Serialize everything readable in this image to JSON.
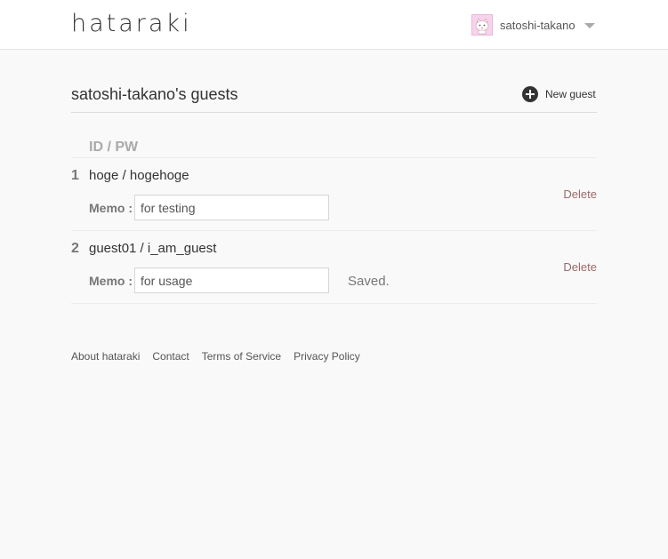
{
  "header": {
    "logo": "hataraki",
    "user_name": "satoshi-takano",
    "avatar_icon": "avatar-cat-icon",
    "menu_icon": "chevron-down-icon"
  },
  "page": {
    "title": "satoshi-takano's guests",
    "new_guest_label": "New guest",
    "new_guest_icon": "plus-circle-icon"
  },
  "table": {
    "column_header": "ID / PW",
    "memo_label": "Memo :",
    "delete_label": "Delete",
    "rows": [
      {
        "number": "1",
        "credentials": "hoge / hogehoge",
        "memo": "for testing",
        "status": ""
      },
      {
        "number": "2",
        "credentials": "guest01 / i_am_guest",
        "memo": "for usage",
        "status": "Saved."
      }
    ]
  },
  "footer": {
    "links": [
      "About hataraki",
      "Contact",
      "Terms of Service",
      "Privacy Policy"
    ]
  }
}
